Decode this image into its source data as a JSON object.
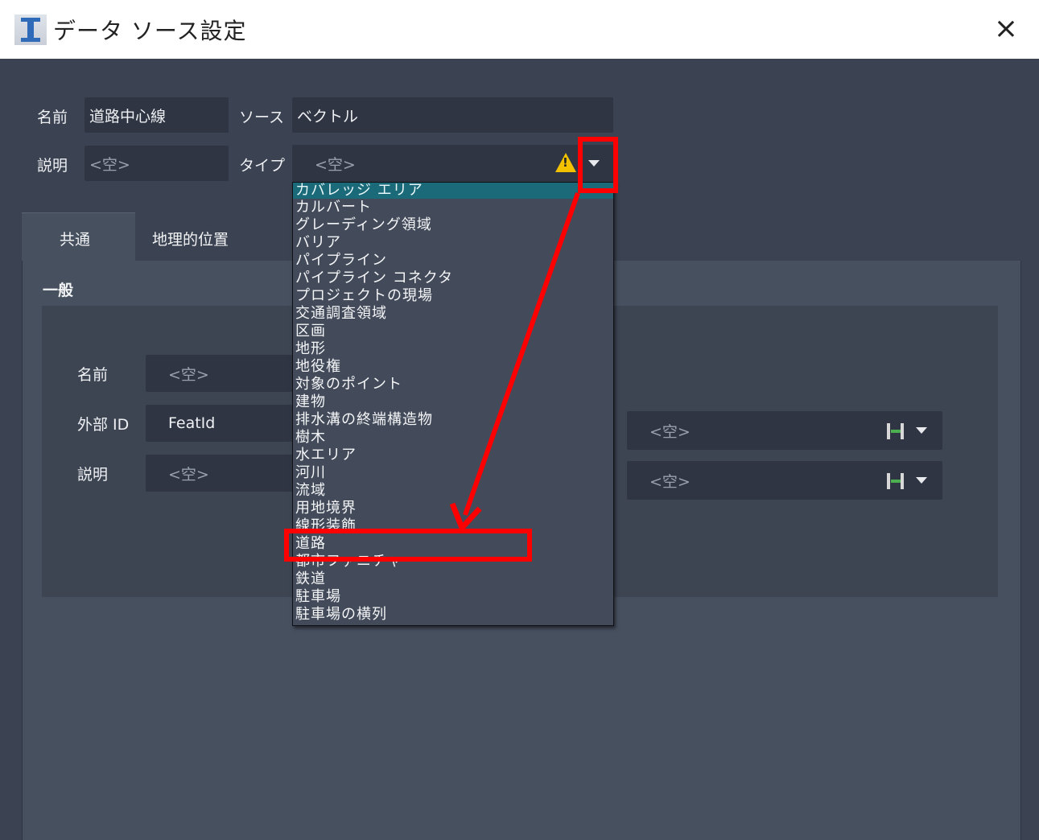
{
  "window": {
    "title": "データ ソース設定",
    "close_glyph": "×"
  },
  "header_fields": {
    "name_label": "名前",
    "name_value": "道路中心線",
    "source_label": "ソース",
    "source_value": "ベクトル",
    "desc_label": "説明",
    "desc_placeholder": "<空>",
    "type_label": "タイプ",
    "type_placeholder": "<空>"
  },
  "tabs": [
    {
      "label": "共通",
      "active": true
    },
    {
      "label": "地理的位置",
      "active": false
    }
  ],
  "panel": {
    "section_title": "一般",
    "rows": [
      {
        "label": "名前",
        "value": "<空>"
      },
      {
        "label": "外部 ID",
        "value": "FeatId"
      },
      {
        "label": "説明",
        "value": "<空>"
      }
    ],
    "right_fields": [
      {
        "value": "<空>",
        "icon": "link-attribute-icon"
      },
      {
        "value": "<空>",
        "icon": "link-attribute-icon"
      }
    ]
  },
  "type_dropdown": {
    "items": [
      "カバレッジ エリア",
      "カルバート",
      "グレーディング領域",
      "バリア",
      "パイプライン",
      "パイプライン コネクタ",
      "プロジェクトの現場",
      "交通調査領域",
      "区画",
      "地形",
      "地役権",
      "対象のポイント",
      "建物",
      "排水溝の終端構造物",
      "樹木",
      "水エリア",
      "河川",
      "流域",
      "用地境界",
      "線形装飾",
      "道路",
      "都市ファニチャ",
      "鉄道",
      "駐車場",
      "駐車場の横列"
    ],
    "selected_index": 0,
    "highlighted_item": "道路"
  },
  "colors": {
    "background": "#3b4251",
    "field": "#2f3542",
    "selected": "#1a6a79",
    "annotation": "#ff0000",
    "warning": "#f2c200"
  }
}
